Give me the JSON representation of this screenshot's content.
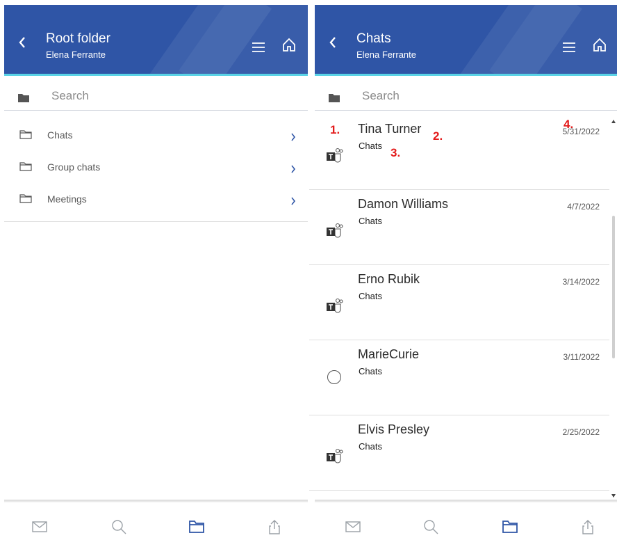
{
  "left": {
    "header": {
      "title": "Root folder",
      "subtitle": "Elena Ferrante"
    },
    "search": {
      "placeholder": "Search"
    },
    "folders": [
      {
        "label": "Chats",
        "icon": "folder-icon"
      },
      {
        "label": "Group chats",
        "icon": "folder-icon"
      },
      {
        "label": "Meetings",
        "icon": "folder-icon"
      }
    ]
  },
  "right": {
    "header": {
      "title": "Chats",
      "subtitle": "Elena Ferrante"
    },
    "search": {
      "placeholder": "Search"
    },
    "chats": [
      {
        "name": "Tina Turner",
        "folder": "Chats",
        "date": "5/31/2022",
        "icon": "teams-icon"
      },
      {
        "name": "Damon Williams",
        "folder": "Chats",
        "date": "4/7/2022",
        "icon": "teams-icon"
      },
      {
        "name": "Erno Rubik",
        "folder": "Chats",
        "date": "3/14/2022",
        "icon": "teams-icon"
      },
      {
        "name": "MarieCurie",
        "folder": "Chats",
        "date": "3/11/2022",
        "icon": "circle-icon"
      },
      {
        "name": "Elvis Presley",
        "folder": "Chats",
        "date": "2/25/2022",
        "icon": "teams-icon"
      }
    ],
    "annotations": [
      "1.",
      "2.",
      "3.",
      "4."
    ]
  },
  "tabbar": [
    "mail-icon",
    "search-icon",
    "folder-icon",
    "share-icon"
  ],
  "colors": {
    "header_bg": "#2f55a6",
    "accent": "#5ad3e6",
    "annotation": "#e31b1b",
    "tab_active": "#2f55a6"
  }
}
